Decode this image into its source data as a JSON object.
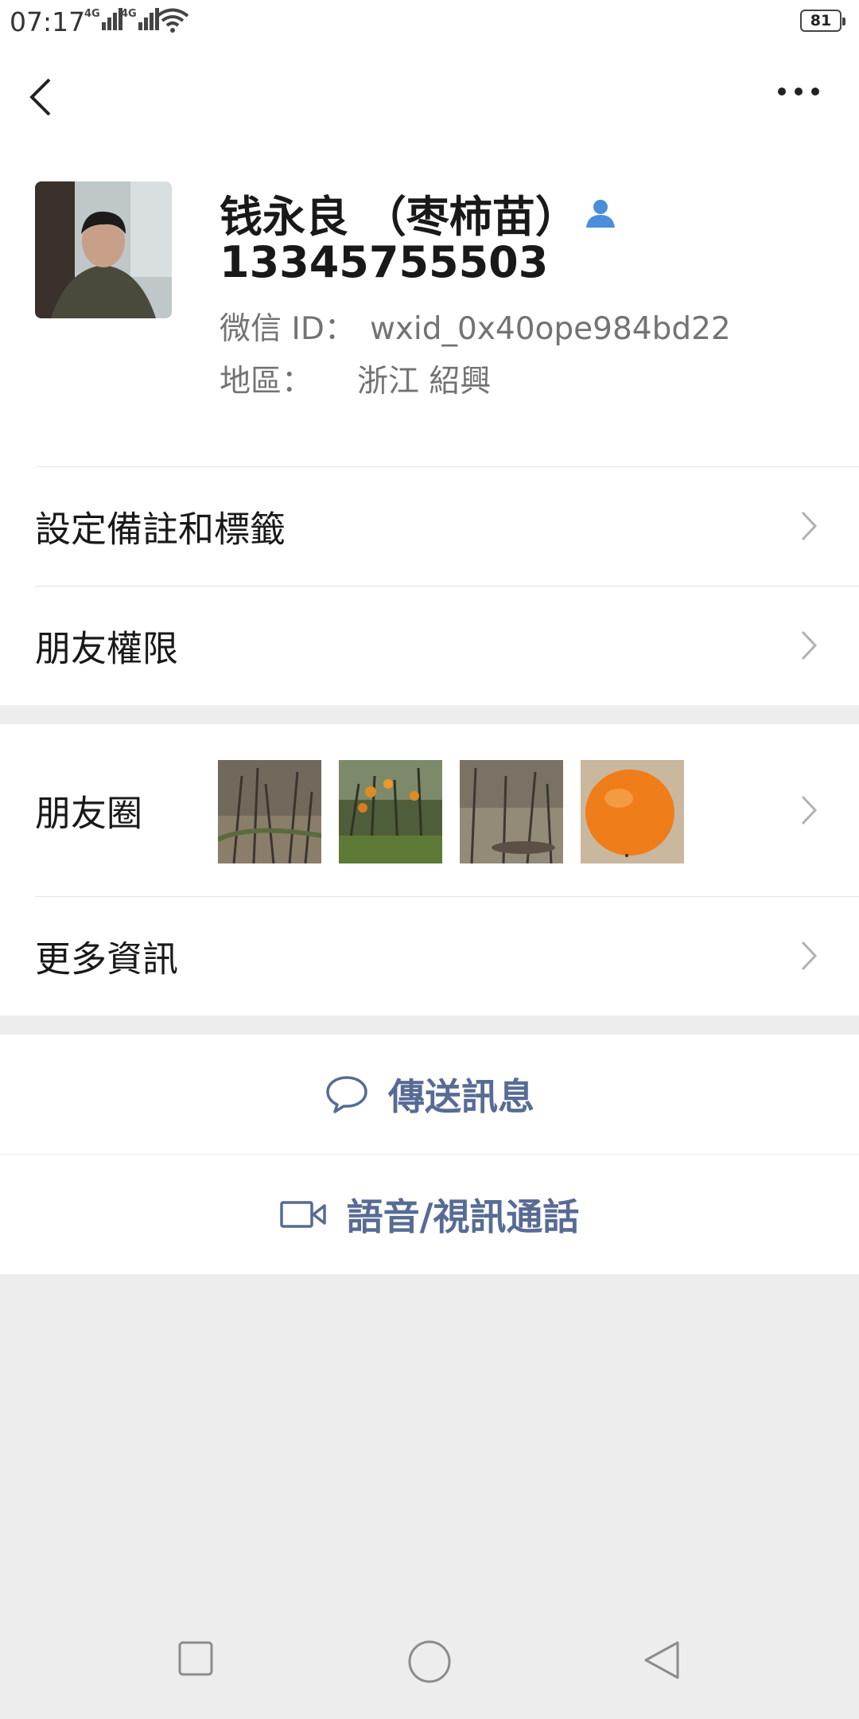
{
  "status_bar": {
    "time": "07:17",
    "network_a": "4G",
    "network_b": "4G",
    "battery": "81"
  },
  "profile": {
    "name": "钱永良 （枣柿苗）",
    "phone": "13345755503",
    "wechat_id_label": "微信 ID：",
    "wechat_id": "wxid_0x40ope984bd22",
    "region_label": "地區：",
    "region": "浙江  紹興"
  },
  "menu": {
    "remarks_tags": "設定備註和標籤",
    "friend_permissions": "朋友權限",
    "moments": "朋友圈",
    "more_info": "更多資訊"
  },
  "actions": {
    "send_message": "傳送訊息",
    "voice_video_call": "語音/視訊通話"
  },
  "colors": {
    "link_blue": "#576b95",
    "background": "#ededed",
    "persimmon": "#ef7d1a"
  },
  "icons": [
    "back-arrow-icon",
    "more-icon",
    "contact-person-icon",
    "chevron-right-icon",
    "chat-bubble-icon",
    "video-camera-icon",
    "nav-recent-icon",
    "nav-home-icon",
    "nav-back-icon"
  ]
}
